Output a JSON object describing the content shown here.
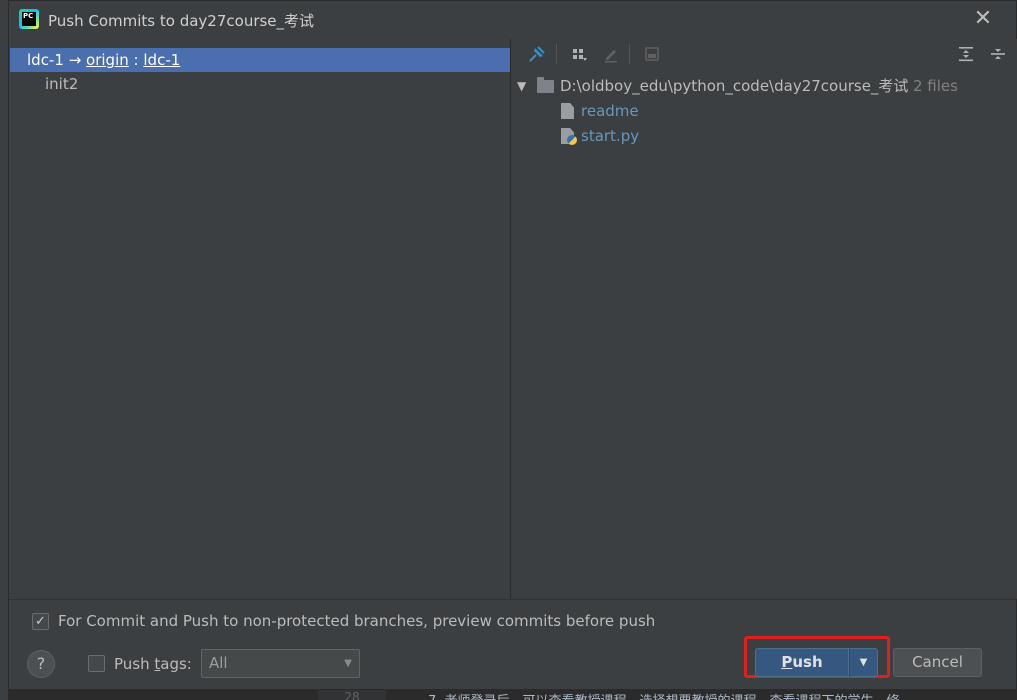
{
  "dialog": {
    "title": "Push Commits to day27course_考试",
    "close_glyph": "✕"
  },
  "commits": {
    "branch": {
      "local": "ldc-1",
      "arrow": "→",
      "remote": "origin",
      "separator": ":",
      "remote_branch": "ldc-1"
    },
    "items": [
      {
        "label": "init2"
      }
    ]
  },
  "toolbar": {
    "icons": [
      "pin-icon",
      "group-by-icon",
      "edit-source-icon",
      "show-diff-icon",
      "expand-all-icon",
      "collapse-all-icon"
    ]
  },
  "changes": {
    "root": {
      "path": "D:\\oldboy_edu\\python_code\\day27course_考试",
      "count": "2 files"
    },
    "files": [
      {
        "name": "readme",
        "icon": "text-file-icon"
      },
      {
        "name": "start.py",
        "icon": "python-file-icon"
      }
    ]
  },
  "options": {
    "preview_label": "For Commit and Push to non-protected branches, preview commits before push",
    "preview_checked": true,
    "push_tags_label_pre": "Push ",
    "push_tags_label_mn": "t",
    "push_tags_label_post": "ags:",
    "push_tags_checked": false,
    "push_tags_value": "All"
  },
  "buttons": {
    "help": "?",
    "push_mn": "P",
    "push_rest": "ush",
    "cancel": "Cancel"
  },
  "background": {
    "line_number": "28",
    "code_snippet": "7.  老师登录后，可以查看教授课程，选择想要教授的课程，查看课程下的学生，修"
  },
  "colors": {
    "selection": "#4b6eaf",
    "file_link": "#6897bb",
    "primary_button": "#365880",
    "highlight_box": "#e0201d"
  }
}
